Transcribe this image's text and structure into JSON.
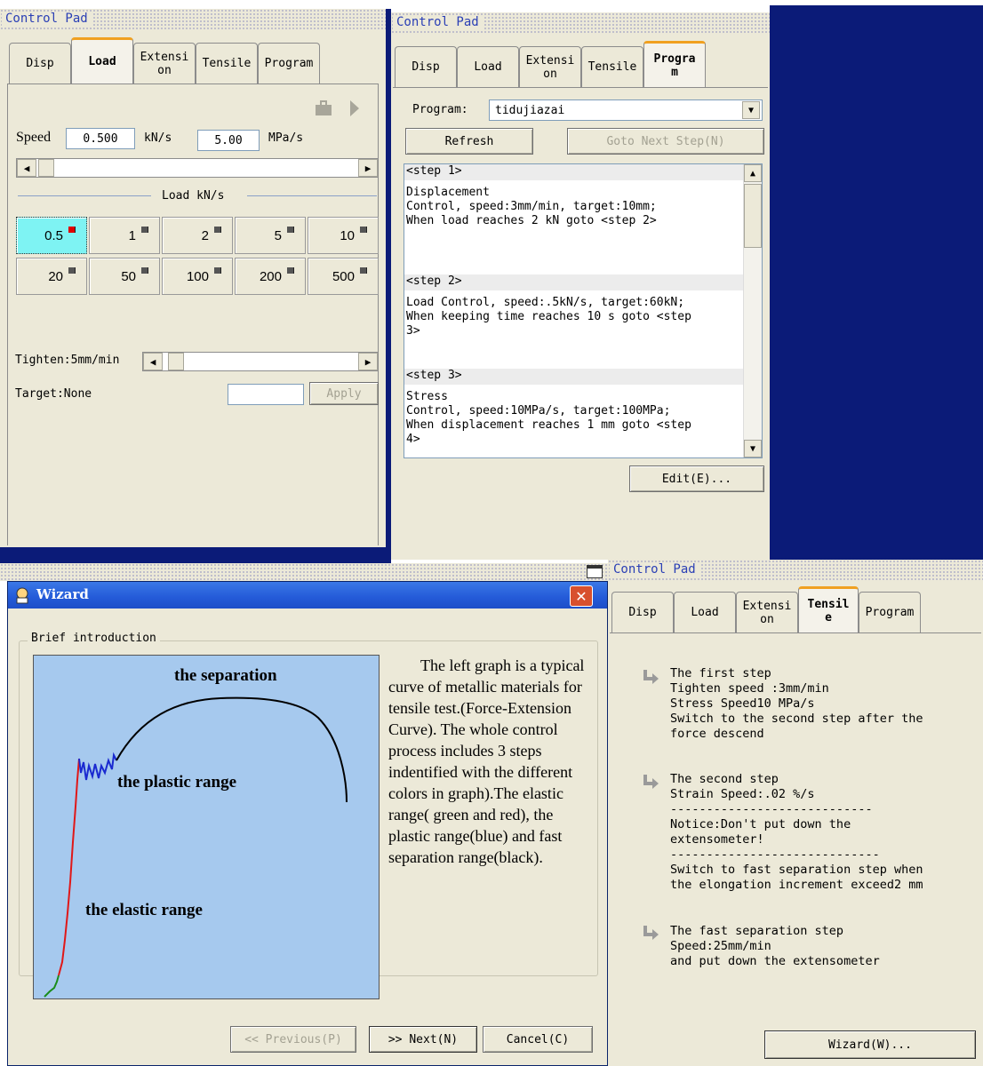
{
  "panel_title": "Control Pad",
  "tabs": [
    "Disp",
    "Load",
    "Extensi\non",
    "Tensile",
    "Program"
  ],
  "tabs_tr": [
    "Disp",
    "Load",
    "Extensi\non",
    "Tensile",
    "Progra\nm"
  ],
  "tabs_br": [
    "Disp",
    "Load",
    "Extensi\non",
    "Tensil\ne",
    "Program"
  ],
  "load_panel": {
    "speed_label": "Speed",
    "speed_value": "0.500",
    "speed_unit": "kN/s",
    "stress_value": "5.00",
    "stress_unit": "MPa/s",
    "load_group_label": "Load kN/s",
    "load_buttons": [
      "0.5",
      "1",
      "2",
      "5",
      "10",
      "20",
      "50",
      "100",
      "200",
      "500"
    ],
    "selected_load": "0.5",
    "tighten_label": "Tighten:5mm/min",
    "target_label": "Target:None",
    "apply_label": "Apply"
  },
  "program_panel": {
    "program_label": "Program:",
    "program_value": "tidujiazai",
    "refresh_label": "Refresh",
    "goto_label": "Goto Next Step(N)",
    "steps": [
      {
        "head": "<step 1>",
        "body": "Displacement\nControl, speed:3mm/min, target:10mm;\nWhen load reaches 2 kN goto <step 2>"
      },
      {
        "head": "<step 2>",
        "body": "Load Control, speed:.5kN/s, target:60kN;\nWhen keeping time reaches 10 s goto <step\n3>"
      },
      {
        "head": "<step 3>",
        "body": "Stress\nControl, speed:10MPa/s, target:100MPa;\nWhen displacement reaches 1 mm goto <step\n4>"
      }
    ],
    "edit_label": "Edit(E)..."
  },
  "wizard": {
    "title": "Wizard",
    "group_label": "Brief introduction",
    "graph_labels": {
      "separation": "the separation",
      "plastic": "the plastic range",
      "elastic": "the elastic range"
    },
    "description": "The left graph is a typical curve of metallic materials for tensile test.(Force-Extension Curve). The whole control process includes 3 steps indentified with the different colors in graph).The elastic range( green and red), the plastic range(blue) and fast separation range(black).",
    "prev_label": "<< Previous(P)",
    "next_label": ">> Next(N)",
    "cancel_label": "Cancel(C)"
  },
  "tensile_panel": {
    "steps": [
      "The first step\n  Tighten speed :3mm/min\n  Stress Speed10 MPa/s\n  Switch to the second step after the\nforce descend",
      "The second step\n  Strain Speed:.02 %/s\n  ----------------------------\n  Notice:Don't put down the\nextensometer!\n  -----------------------------\n Switch to fast separation step when\nthe elongation increment exceed2 mm",
      "The fast separation step\n  Speed:25mm/min\nand put down the extensometer"
    ],
    "wizard_button": "Wizard(W)..."
  },
  "colors": {
    "navy": "#0b1b78",
    "panel": "#ece9d8",
    "graph_bg": "#a6c9ee",
    "elastic_green": "#1a8c1a",
    "elastic_red": "#e01818",
    "plastic_blue": "#1a2ad0",
    "separation_black": "#000000",
    "wizard_title": "#2c5fd6"
  }
}
